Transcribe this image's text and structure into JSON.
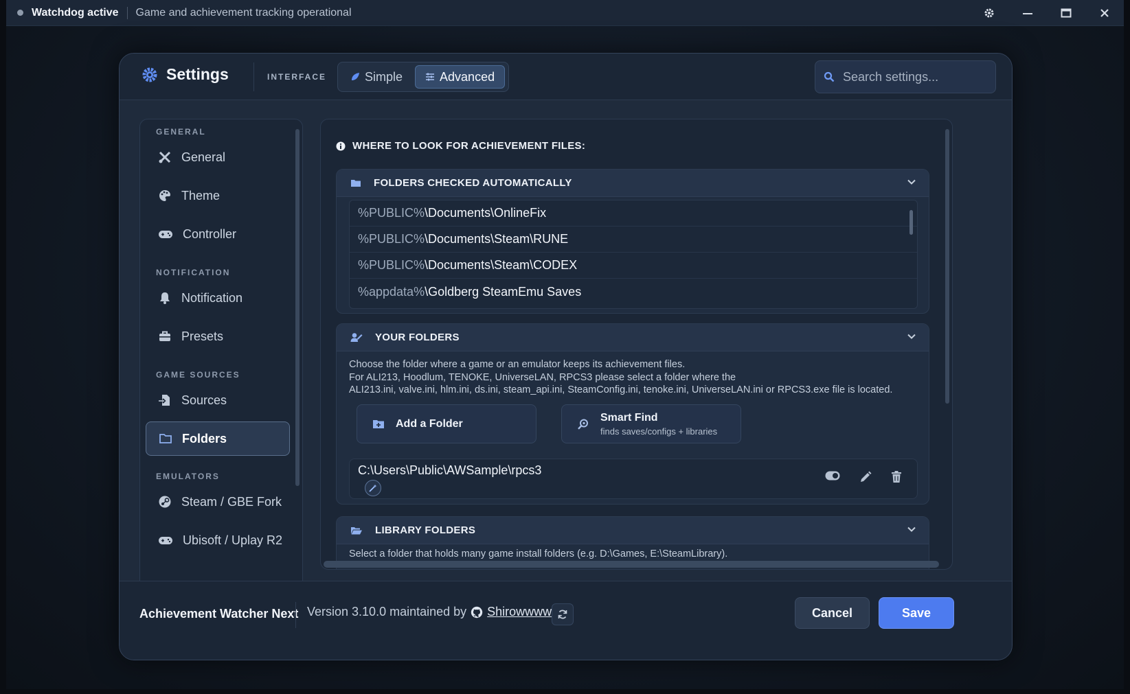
{
  "titlebar": {
    "title": "Watchdog active",
    "status": "Game and achievement tracking operational",
    "icons": [
      "gear-icon",
      "minimize-icon",
      "maximize-icon",
      "close-icon"
    ]
  },
  "header": {
    "title": "Settings",
    "interface_label": "INTERFACE",
    "modes": [
      {
        "label": "Simple",
        "active": false
      },
      {
        "label": "Advanced",
        "active": true
      }
    ],
    "search_placeholder": "Search settings..."
  },
  "sidebar": {
    "sections": [
      {
        "label": "GENERAL",
        "items": [
          {
            "label": "General",
            "icon": "tools-icon"
          },
          {
            "label": "Theme",
            "icon": "palette-icon"
          },
          {
            "label": "Controller",
            "icon": "gamepad-icon"
          }
        ]
      },
      {
        "label": "NOTIFICATION",
        "items": [
          {
            "label": "Notification",
            "icon": "bell-icon"
          },
          {
            "label": "Presets",
            "icon": "toolbox-icon"
          }
        ]
      },
      {
        "label": "GAME SOURCES",
        "items": [
          {
            "label": "Sources",
            "icon": "file-import-icon"
          },
          {
            "label": "Folders",
            "icon": "folder-icon",
            "active": true
          }
        ]
      },
      {
        "label": "EMULATORS",
        "items": [
          {
            "label": "Steam / GBE Fork",
            "icon": "steam-icon"
          },
          {
            "label": "Ubisoft / Uplay R2",
            "icon": "gamepad-icon"
          }
        ]
      }
    ]
  },
  "content": {
    "where_title": "WHERE TO LOOK FOR ACHIEVEMENT FILES:",
    "auto_panel": {
      "title": "FOLDERS CHECKED AUTOMATICALLY",
      "rows": [
        {
          "var": "%PUBLIC%",
          "path": "\\Documents\\OnlineFix"
        },
        {
          "var": "%PUBLIC%",
          "path": "\\Documents\\Steam\\RUNE"
        },
        {
          "var": "%PUBLIC%",
          "path": "\\Documents\\Steam\\CODEX"
        },
        {
          "var": "%appdata%",
          "path": "\\Goldberg SteamEmu Saves"
        }
      ]
    },
    "your_panel": {
      "title": "YOUR FOLDERS",
      "desc_lines": [
        "Choose the folder where a game or an emulator keeps its achievement files.",
        "For ALI213, Hoodlum, TENOKE, UniverseLAN, RPCS3 please select a folder where the",
        "ALI213.ini, valve.ini, hlm.ini, ds.ini, steam_api.ini, SteamConfig.ini, tenoke.ini, UniverseLAN.ini or RPCS3.exe file is located."
      ],
      "add_label": "Add a Folder",
      "smart_label": "Smart Find",
      "smart_sub": "finds saves/configs + libraries",
      "folders": [
        {
          "path": "C:\\Users\\Public\\AWSample\\rpcs3"
        }
      ]
    },
    "library_panel": {
      "title": "LIBRARY FOLDERS",
      "desc": "Select a folder that holds many game install folders (e.g. D:\\Games, E:\\SteamLibrary)."
    }
  },
  "footer": {
    "app_name": "Achievement Watcher Next",
    "version_text": "Version 3.10.0 maintained by",
    "author": "Shirowwww",
    "cancel_label": "Cancel",
    "save_label": "Save"
  },
  "colors": {
    "accent": "#4d7bef",
    "active_item_border": "#5a6f8c"
  }
}
